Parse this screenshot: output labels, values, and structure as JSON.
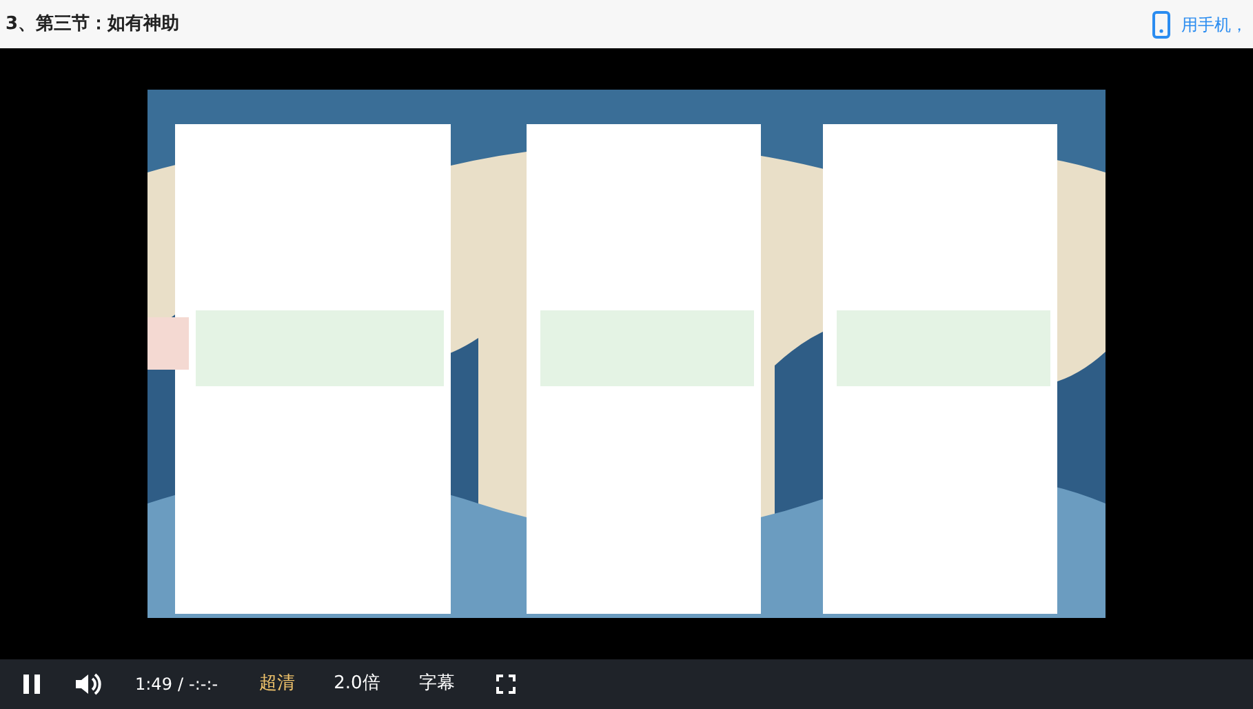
{
  "title": "3、第三节：如有神助",
  "mobile_hint": "用手机，",
  "controls": {
    "playing": true,
    "current_time": "1:49",
    "separator": "/",
    "duration": "-:-:-",
    "options": [
      {
        "label": "超清",
        "selected": true
      },
      {
        "label": "2.0倍",
        "selected": false
      },
      {
        "label": "字幕",
        "selected": false
      }
    ]
  }
}
